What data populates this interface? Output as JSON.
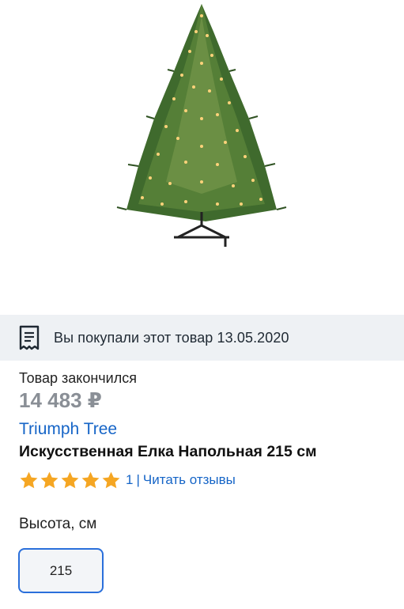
{
  "product_image": {
    "alt": "Искусственная Елка Напольная 215 см"
  },
  "purchase_notice": {
    "icon": "receipt-icon",
    "text": "Вы покупали этот товар 13.05.2020"
  },
  "product": {
    "status": "Товар закончился",
    "price": "14 483 ₽",
    "brand": "Triumph Tree",
    "title": "Искусственная Елка Напольная 215 см",
    "rating": {
      "value": 5,
      "max": 5,
      "count": "1",
      "separator": "|",
      "reviews_link": "Читать отзывы"
    }
  },
  "options": {
    "height_label": "Высота, см",
    "height_values": [
      "215"
    ],
    "selected": "215"
  },
  "colors": {
    "accent": "#1665c7",
    "star": "#f5a623",
    "price_gray": "#8a8f96",
    "notice_bg": "#eef1f4"
  }
}
